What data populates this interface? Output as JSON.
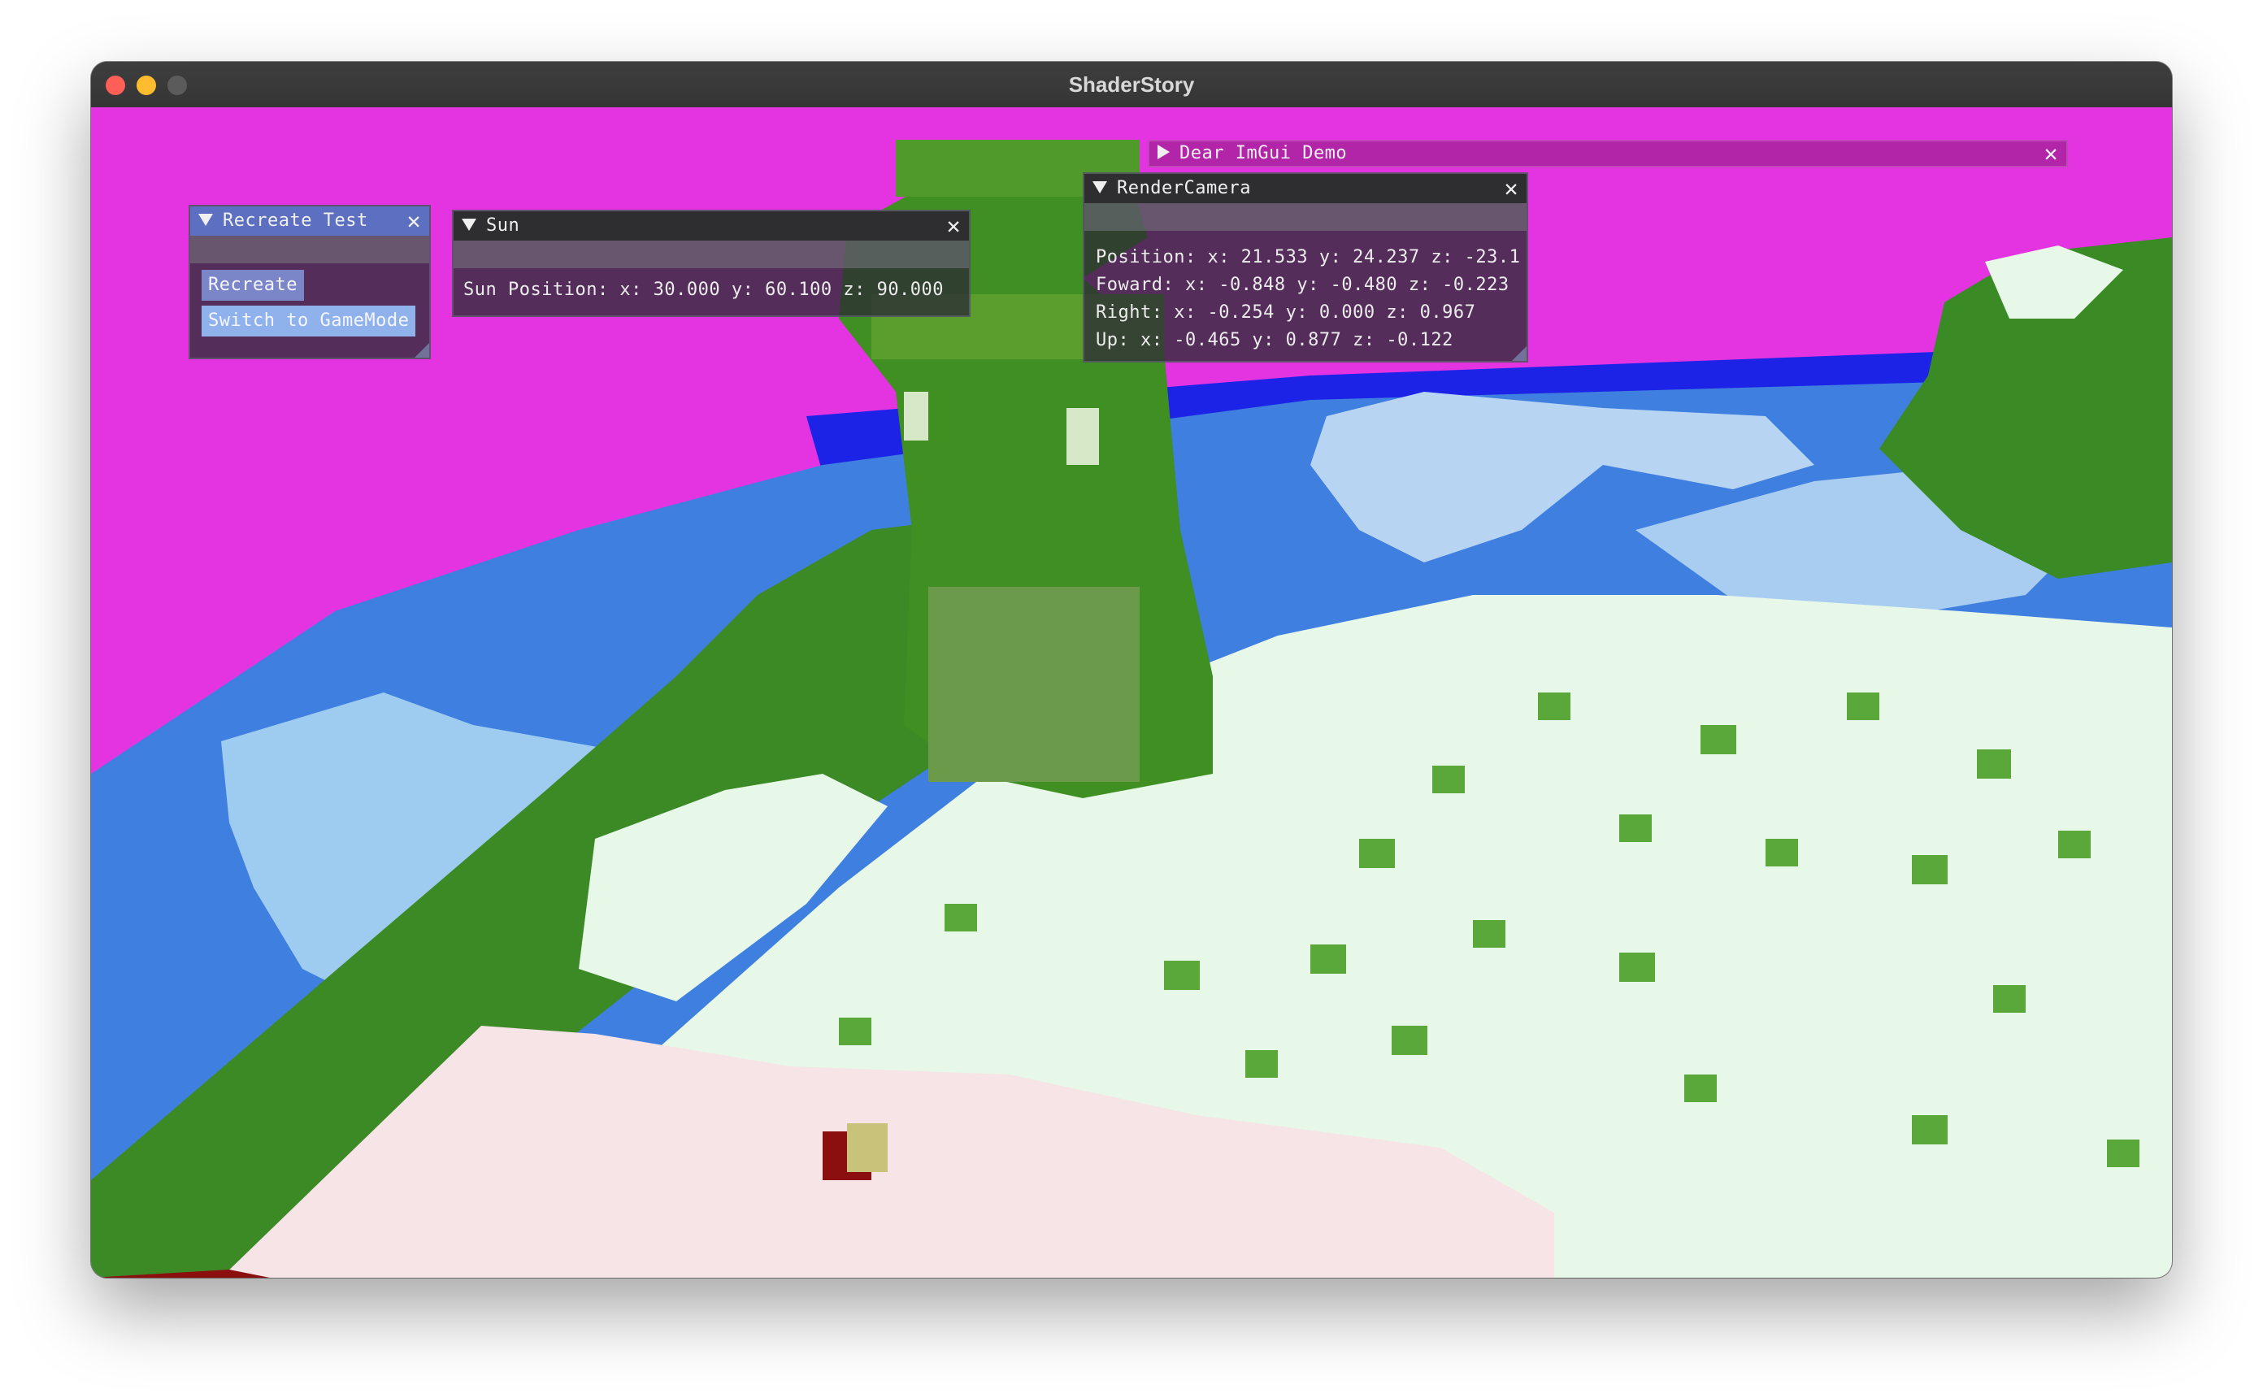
{
  "app": {
    "title": "ShaderStory"
  },
  "colors": {
    "sky": "#e433e0",
    "water": "#3f7fe0",
    "snow": "#e4f7e6",
    "grass": "#3f8c26"
  },
  "recreate_test": {
    "title": "Recreate Test",
    "buttons": {
      "recreate": "Recreate",
      "switch_mode": "Switch to GameMode"
    }
  },
  "sun": {
    "title": "Sun",
    "position_line": "Sun Position: x: 30.000 y: 60.100 z: 90.000"
  },
  "demo": {
    "title": "Dear ImGui Demo"
  },
  "render_camera": {
    "title": "RenderCamera",
    "lines": [
      "Position: x: 21.533 y: 24.237 z: -23.1",
      "Foward: x: -0.848 y: -0.480 z: -0.223",
      "Right: x: -0.254 y: 0.000 z: 0.967",
      "Up: x: -0.465 y: 0.877 z: -0.122"
    ]
  }
}
